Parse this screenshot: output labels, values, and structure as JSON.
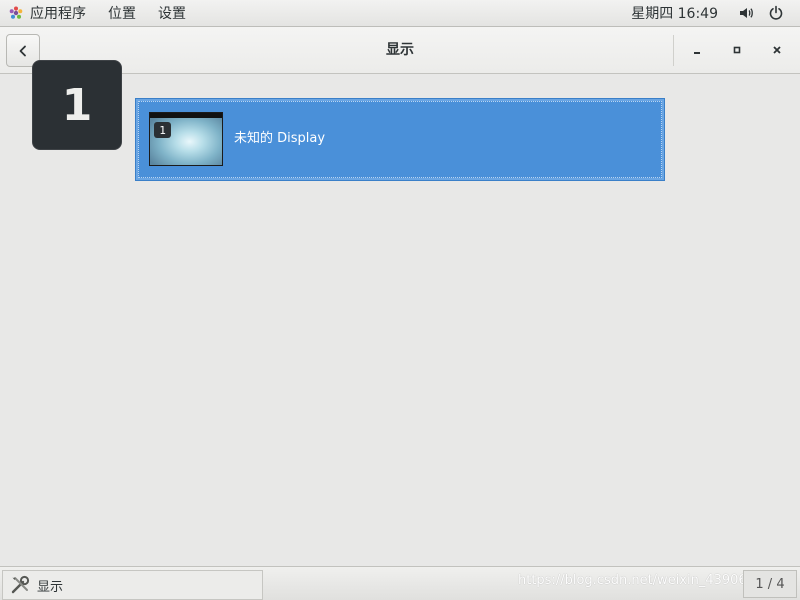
{
  "topbar": {
    "apps_label": "应用程序",
    "places_label": "位置",
    "settings_label": "设置",
    "clock": "星期四 16:49",
    "icons": [
      "volume-icon",
      "power-icon"
    ]
  },
  "window": {
    "title": "显示",
    "back_icon": "chevron-left-icon",
    "controls": [
      "minimize-icon",
      "maximize-icon",
      "close-icon"
    ]
  },
  "displays": {
    "monitor_number": "1",
    "items": [
      {
        "number": "1",
        "name": "未知的  Display",
        "selected": true
      }
    ]
  },
  "taskbar": {
    "task_label": "显示",
    "task_icon": "settings-tools-icon",
    "watermark": "https://blog.csdn.net/weixin_43906",
    "pager": "1 / 4"
  },
  "colors": {
    "selection": "#4a90d9",
    "monitor_label_bg": "#2b3034",
    "background": "#e8e8e7"
  }
}
